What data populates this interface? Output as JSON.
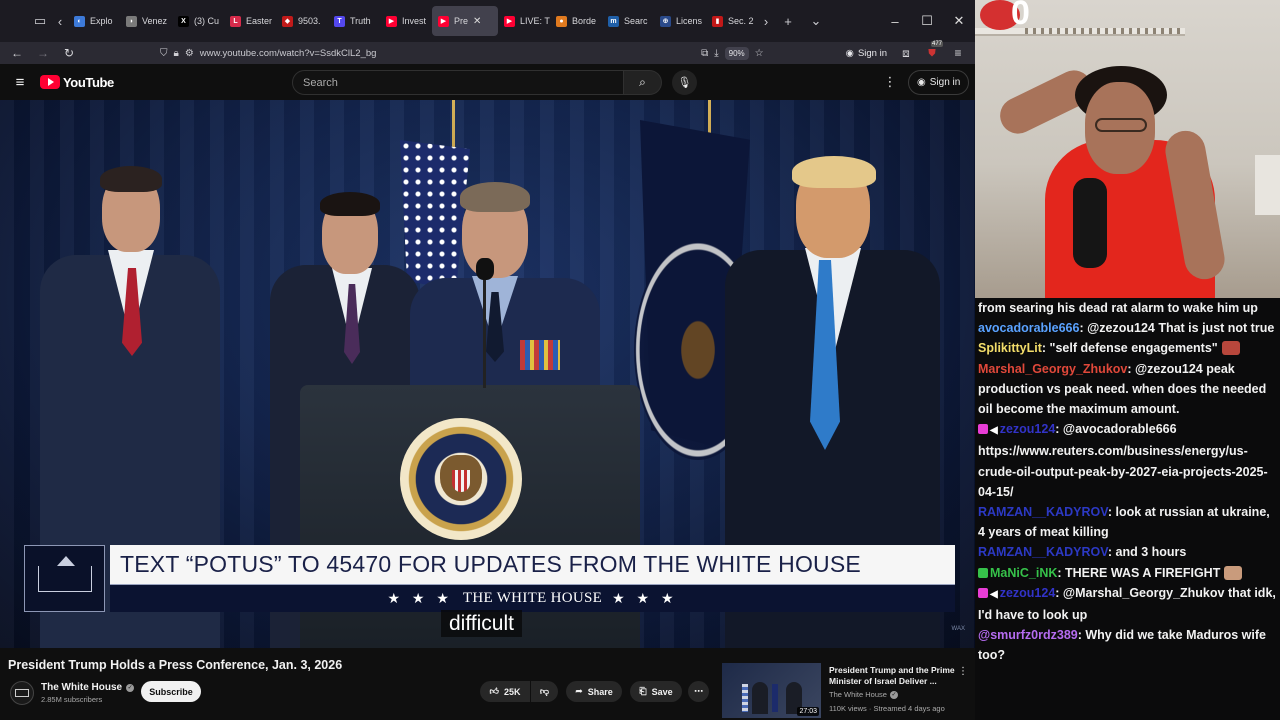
{
  "browser": {
    "tabs": [
      {
        "label": "Explo",
        "fav_color": "#3d7ad9",
        "fav_glyph": "◐",
        "active": false
      },
      {
        "label": "Venez",
        "fav_color": "#7a7a7a",
        "fav_glyph": "◗",
        "active": false
      },
      {
        "label": "(3) Cu",
        "fav_color": "#000000",
        "fav_glyph": "X",
        "active": false
      },
      {
        "label": "Easter",
        "fav_color": "#d62b4b",
        "fav_glyph": "L",
        "active": false
      },
      {
        "label": "9503.",
        "fav_color": "#c11a1a",
        "fav_glyph": "◆",
        "active": false
      },
      {
        "label": "Truth",
        "fav_color": "#5448ee",
        "fav_glyph": "T",
        "active": false
      },
      {
        "label": "Invest",
        "fav_color": "#ff0033",
        "fav_glyph": "▶",
        "active": false
      },
      {
        "label": "Pre",
        "fav_color": "#ff0033",
        "fav_glyph": "▶",
        "active": true
      },
      {
        "label": "LIVE: T",
        "fav_color": "#ff0033",
        "fav_glyph": "▶",
        "active": false
      },
      {
        "label": "Borde",
        "fav_color": "#e07a1f",
        "fav_glyph": "●",
        "active": false
      },
      {
        "label": "Searc",
        "fav_color": "#1f5fa8",
        "fav_glyph": "m",
        "active": false
      },
      {
        "label": "Licens",
        "fav_color": "#2a4a8a",
        "fav_glyph": "⊕",
        "active": false
      },
      {
        "label": "Sec. 2",
        "fav_color": "#c21818",
        "fav_glyph": "▮",
        "active": false
      }
    ],
    "url": "www.youtube.com/watch?v=SsdkClL2_bg",
    "zoom": "90%",
    "signin": "Sign in",
    "extension_badge": "477"
  },
  "youtube": {
    "logo_text": "YouTube",
    "search_placeholder": "Search",
    "signin": "Sign in"
  },
  "video": {
    "lower_third": "TEXT “POTUS” TO 45470 FOR UPDATES FROM THE WHITE HOUSE",
    "strip_label": "THE WHITE HOUSE",
    "stars": "★ ★ ★",
    "caption": "difficult",
    "watermark": "WAX"
  },
  "meta": {
    "title": "President Trump Holds a Press Conference, Jan. 3, 2026",
    "channel": "The White House",
    "subscribers": "2.85M subscribers",
    "subscribe": "Subscribe",
    "likes": "25K",
    "share": "Share",
    "save": "Save"
  },
  "recommended": {
    "title": "President Trump and the Prime Minister of Israel Deliver ...",
    "channel": "The White House",
    "meta": "110K views · Streamed 4 days ago",
    "duration": "27:03"
  },
  "webcam": {
    "overlay_number": "0"
  },
  "chat": [
    {
      "user": "",
      "user_color": "#ffffff",
      "text": "from searing his dead rat alarm to wake him up",
      "badges": []
    },
    {
      "user": "avocadorable666",
      "user_color": "#5aa2ff",
      "text": ": @zezou124 That is just not true",
      "badges": []
    },
    {
      "user": "SplikittyLit",
      "user_color": "#f3dd6a",
      "text": ": \"self defense engagements\"",
      "badges": [],
      "emote": "#b8473c"
    },
    {
      "user": "Marshal_Georgy_Zhukov",
      "user_color": "#e0483a",
      "text": ": @zezou124 peak production vs peak need. when does the needed oil become the maximum amount.",
      "badges": []
    },
    {
      "user": "zezou124",
      "user_color": "#3233c8",
      "text": ": @avocadorable666 https://www.reuters.com/business/energy/us-crude-oil-output-peak-by-2027-eia-projects-2025-04-15/",
      "badges": [
        "#e83dd6",
        "speaker"
      ]
    },
    {
      "user": "RAMZAN__KADYROV",
      "user_color": "#2c39c4",
      "text": ": look at russian at ukraine, 4 years of meat killing",
      "badges": []
    },
    {
      "user": "RAMZAN__KADYROV",
      "user_color": "#2c39c4",
      "text": ": and 3 hours",
      "badges": []
    },
    {
      "user": "MaNiC_iNK",
      "user_color": "#36c24a",
      "text": ": THERE WAS A FIREFIGHT",
      "badges": [
        "#36c24a"
      ],
      "emote": "#c99b7c"
    },
    {
      "user": "zezou124",
      "user_color": "#3233c8",
      "text": ": @Marshal_Georgy_Zhukov that idk, I'd have to look up",
      "badges": [
        "#e83dd6",
        "speaker"
      ]
    },
    {
      "user": "@smurfz0rdz389",
      "user_color": "#b56cf0",
      "text": ": Why did we take Maduros wife too?",
      "badges": []
    }
  ]
}
